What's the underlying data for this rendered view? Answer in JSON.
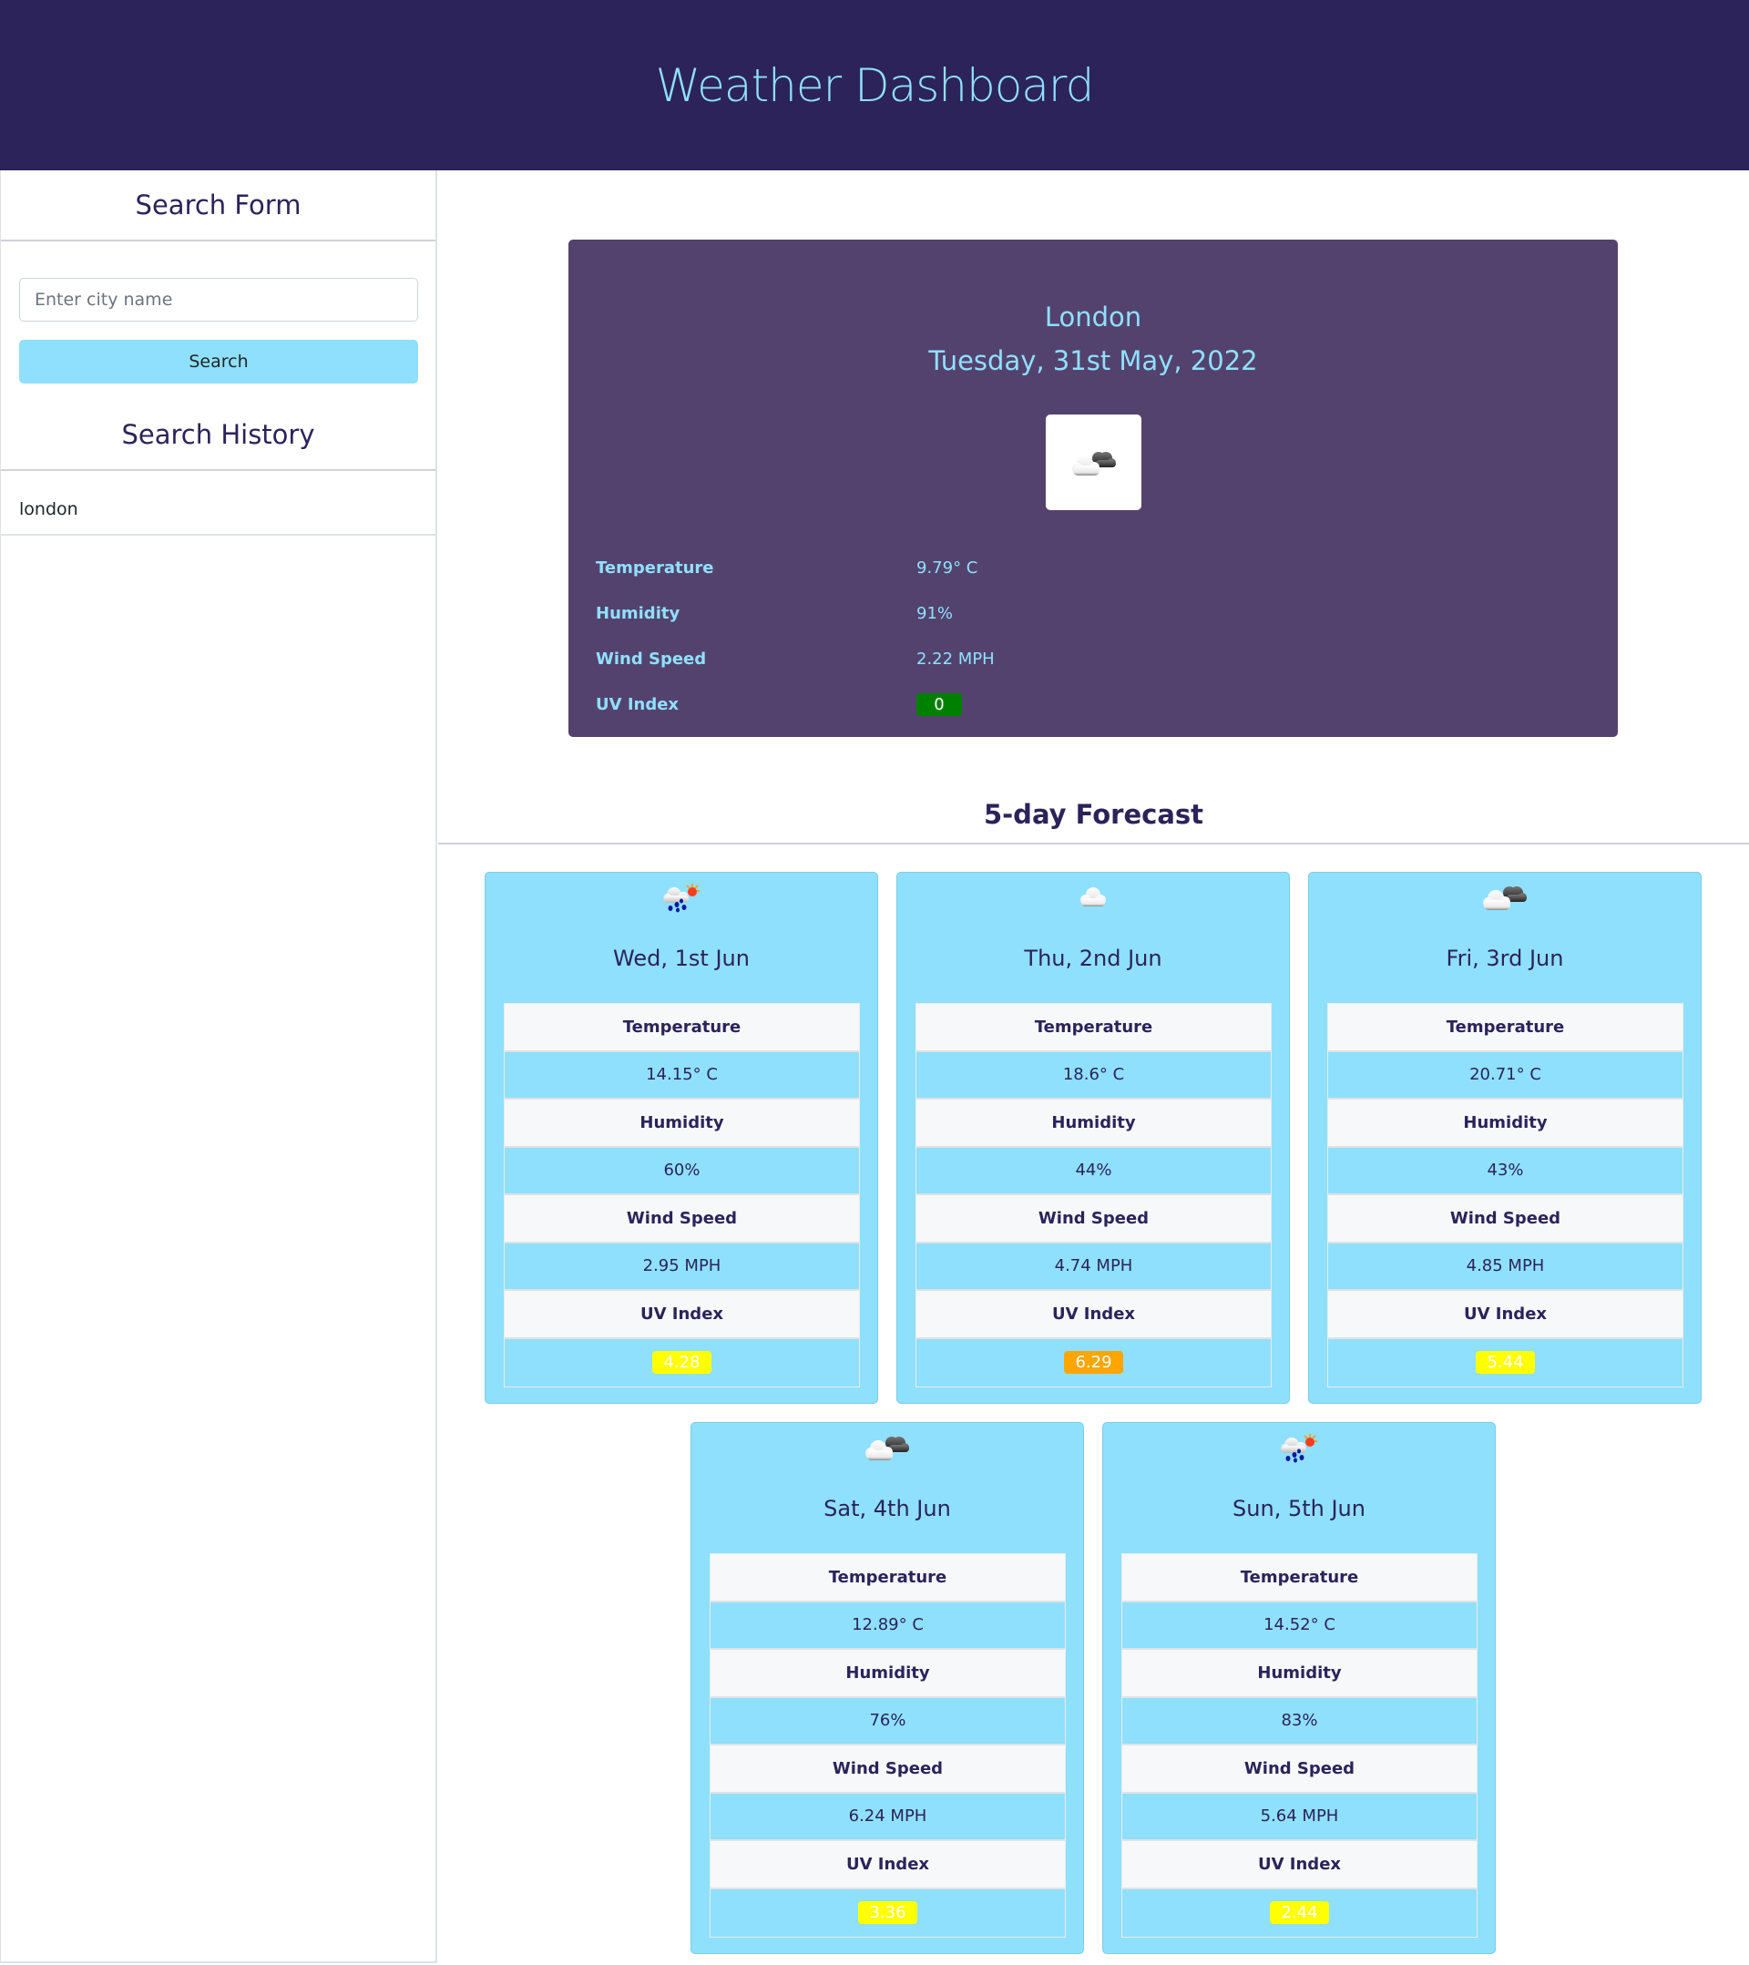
{
  "header": {
    "title": "Weather Dashboard"
  },
  "sidebar": {
    "search_form_title": "Search Form",
    "search_input": {
      "placeholder": "Enter city name",
      "value": ""
    },
    "search_button_label": "Search",
    "history_title": "Search History",
    "history": [
      {
        "label": "london"
      }
    ]
  },
  "current": {
    "city": "London",
    "date": "Tuesday, 31st May, 2022",
    "icon": "broken-clouds-icon",
    "stats": [
      {
        "label": "Temperature",
        "value": "9.79° C"
      },
      {
        "label": "Humidity",
        "value": "91%"
      },
      {
        "label": "Wind Speed",
        "value": "2.22 MPH"
      },
      {
        "label": "UV Index",
        "value": "0",
        "uv_color": "#008000"
      }
    ]
  },
  "forecast": {
    "title": "5-day Forecast",
    "labels": {
      "temperature": "Temperature",
      "humidity": "Humidity",
      "wind": "Wind Speed",
      "uv": "UV Index"
    },
    "days": [
      {
        "date": "Wed, 1st Jun",
        "icon": "rain-sun-icon",
        "temperature": "14.15° C",
        "humidity": "60%",
        "wind": "2.95 MPH",
        "uv": "4.28",
        "uv_color": "#ffff00"
      },
      {
        "date": "Thu, 2nd Jun",
        "icon": "cloud-icon",
        "temperature": "18.6° C",
        "humidity": "44%",
        "wind": "4.74 MPH",
        "uv": "6.29",
        "uv_color": "#ffa500"
      },
      {
        "date": "Fri, 3rd Jun",
        "icon": "broken-clouds-icon",
        "temperature": "20.71° C",
        "humidity": "43%",
        "wind": "4.85 MPH",
        "uv": "5.44",
        "uv_color": "#ffff00"
      },
      {
        "date": "Sat, 4th Jun",
        "icon": "broken-clouds-icon",
        "temperature": "12.89° C",
        "humidity": "76%",
        "wind": "6.24 MPH",
        "uv": "3.36",
        "uv_color": "#ffff00"
      },
      {
        "date": "Sun, 5th Jun",
        "icon": "rain-sun-icon",
        "temperature": "14.52° C",
        "humidity": "83%",
        "wind": "5.64 MPH",
        "uv": "2.44",
        "uv_color": "#ffff00"
      }
    ]
  },
  "colors": {
    "header_bg": "#2c235a",
    "accent": "#8fe0fd",
    "current_card_bg": "#54426e",
    "uv_low": "#008000",
    "uv_moderate": "#ffff00",
    "uv_high": "#ffa500"
  }
}
